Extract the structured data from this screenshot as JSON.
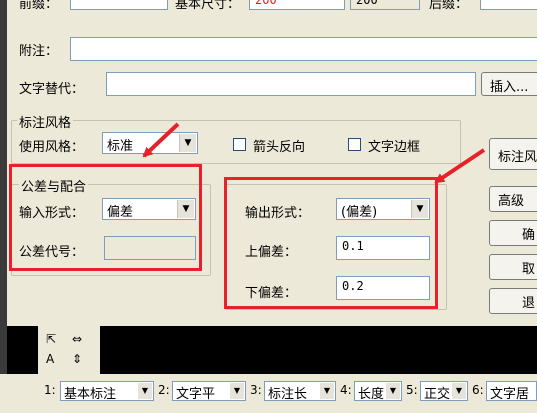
{
  "top_row": {
    "prefix_label": "前缀：",
    "basic_size_label": "基本尺寸：",
    "basic_size_value": "200",
    "basic_size_value2": "200",
    "suffix_label": "后缀："
  },
  "note": {
    "label": "附注：",
    "value": ""
  },
  "text_replace": {
    "label": "文字替代：",
    "value": "",
    "insert_button": "插入..."
  },
  "style_group": {
    "title": "标注风格",
    "use_style_label": "使用风格：",
    "use_style_value": "标准",
    "arrow_reverse_label": "箭头反向",
    "text_border_label": "文字边框",
    "style_button": "标注风"
  },
  "tolerance_group": {
    "title": "公差与配合",
    "input_form_label": "输入形式：",
    "input_form_value": "偏差",
    "tolerance_code_label": "公差代号：",
    "tolerance_code_value": ""
  },
  "output_group": {
    "output_form_label": "输出形式：",
    "output_form_value": "(偏差)",
    "upper_label": "上偏差：",
    "upper_value": "0.1",
    "lower_label": "下偏差：",
    "lower_value": "0.2"
  },
  "side_buttons": {
    "advanced": "高级",
    "ok": "确",
    "cancel": "取",
    "exit": "退"
  },
  "accent_colors": {
    "annotation_red": "#e8202a",
    "value_red": "#d22222"
  },
  "bottom_toolbar": {
    "icons": [
      "dimension-icon",
      "horizontal-dimension-icon",
      "text-dimension-icon",
      "vertical-dimension-icon"
    ],
    "fields": [
      {
        "num": "1:",
        "value": "基本标注"
      },
      {
        "num": "2:",
        "value": "文字平"
      },
      {
        "num": "3:",
        "value": "标注长"
      },
      {
        "num": "4:",
        "value": "长度"
      },
      {
        "num": "5:",
        "value": "正交"
      },
      {
        "num": "6:",
        "value": "文字居"
      }
    ]
  }
}
